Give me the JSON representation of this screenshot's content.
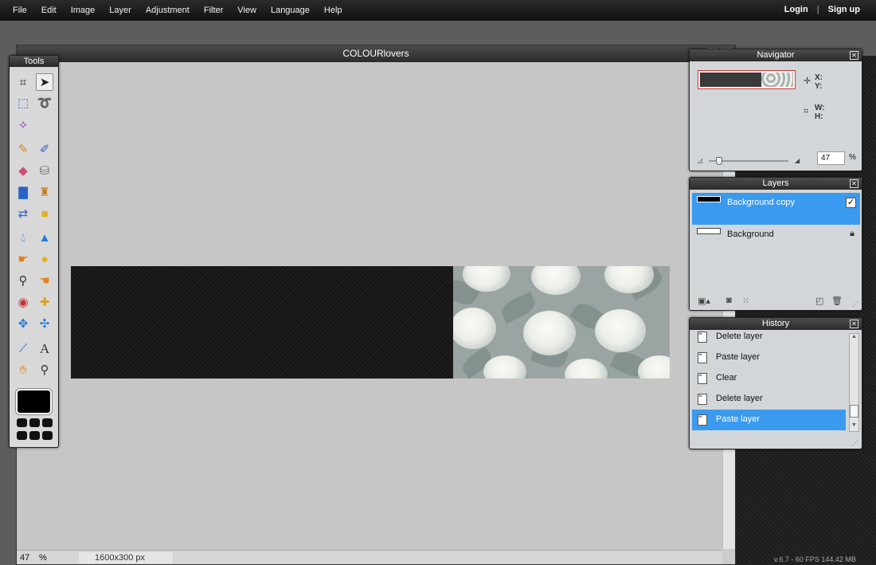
{
  "menu": {
    "items": [
      "File",
      "Edit",
      "Image",
      "Layer",
      "Adjustment",
      "Filter",
      "View",
      "Language",
      "Help"
    ],
    "login": "Login",
    "separator": "|",
    "signup": "Sign up"
  },
  "document": {
    "title": "COLOURlovers",
    "zoom": "47",
    "zoom_unit": "%",
    "size": "1600x300 px"
  },
  "tools": {
    "title": "Tools",
    "icons": [
      "crop-icon",
      "move-icon",
      "marquee-icon",
      "lasso-icon",
      "magic-wand-icon",
      "pencil-icon",
      "brush-icon",
      "eraser-icon",
      "bucket-icon",
      "gradient-icon",
      "stamp-icon",
      "replace-color-icon",
      "shape-icon",
      "blur-icon",
      "sharpen-icon",
      "smudge-icon",
      "sponge-icon",
      "dodge-icon",
      "burn-icon",
      "red-eye-icon",
      "spot-heal-icon",
      "bloat-icon",
      "pinch-icon",
      "color-picker-icon",
      "text-icon",
      "hand-icon",
      "zoom-icon"
    ]
  },
  "navigator": {
    "title": "Navigator",
    "x_label": "X:",
    "y_label": "Y:",
    "w_label": "W:",
    "h_label": "H:",
    "zoom": "47",
    "zoom_unit": "%",
    "zoom_slider_value": 47
  },
  "layers": {
    "title": "Layers",
    "items": [
      {
        "name": "Background copy",
        "selected": true,
        "visible": true
      },
      {
        "name": "Background",
        "selected": false,
        "locked": true
      }
    ]
  },
  "history": {
    "title": "History",
    "items": [
      {
        "label": "Delete layer",
        "selected": false
      },
      {
        "label": "Paste layer",
        "selected": false
      },
      {
        "label": "Clear",
        "selected": false
      },
      {
        "label": "Delete layer",
        "selected": false
      },
      {
        "label": "Paste layer",
        "selected": true
      }
    ]
  },
  "status": {
    "version": "v.6.7 - 60 FPS 144.42 MB"
  },
  "colors": {
    "selection": "#3a9af0",
    "canvas_bg": "#c6c6c6",
    "foreground": "#000000"
  }
}
